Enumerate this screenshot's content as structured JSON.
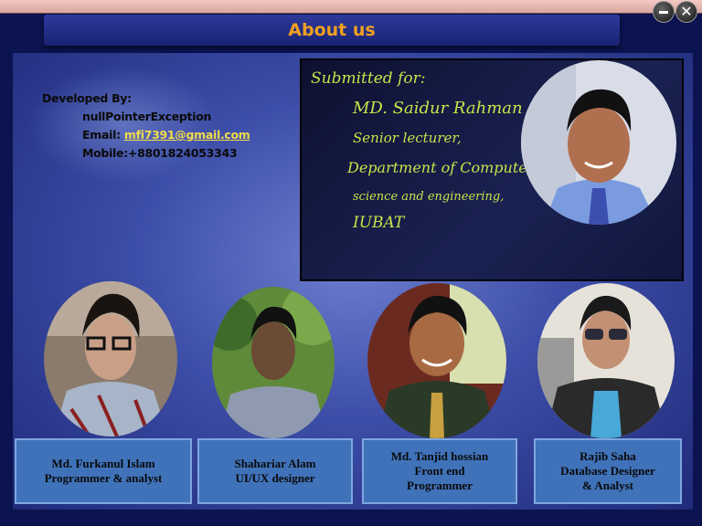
{
  "window": {
    "title": "About us",
    "minimize_label": "",
    "close_label": "✕"
  },
  "developer": {
    "heading": "Developed By:",
    "name": "nullPointerException",
    "email_label": "Email:",
    "email": "mfi7391@gmail.com",
    "mobile_label": "Mobile:",
    "mobile": "+8801824053343"
  },
  "submitted": {
    "heading": "Submitted for:",
    "lines": [
      "MD. Saidur Rahman",
      "Senior lecturer,",
      "Department of Computer",
      "science and engineering,",
      "IUBAT"
    ]
  },
  "team": [
    {
      "lines": [
        "Md. Furkanul Islam",
        "Programmer & analyst"
      ]
    },
    {
      "lines": [
        "Shahariar Alam",
        "UI/UX designer"
      ]
    },
    {
      "lines": [
        "Md. Tanjid hossian",
        "Front  end",
        "Programmer"
      ]
    },
    {
      "lines": [
        "Rajib Saha",
        "Database Designer",
        "& Analyst"
      ]
    }
  ],
  "colors": {
    "title": "#f0a020",
    "submitted_text": "#c9e34a",
    "email_link": "#f4dc4a",
    "team_box": "#3f72b9"
  }
}
